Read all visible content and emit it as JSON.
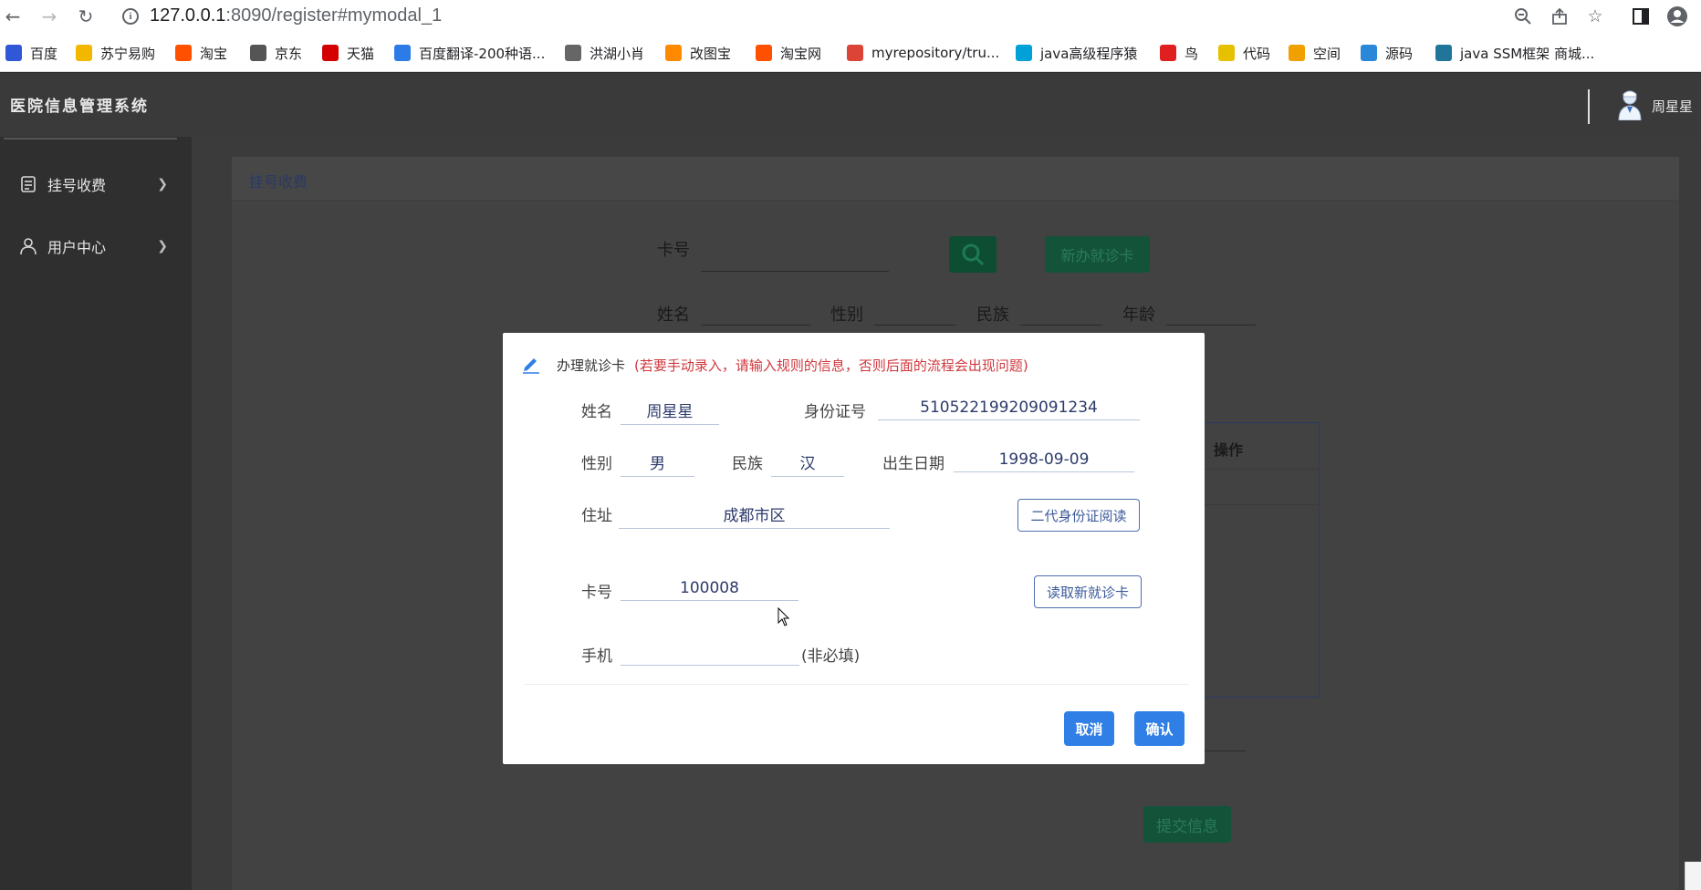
{
  "browser": {
    "url_host": "127.0.0.1",
    "url_rest": ":8090/register#mymodal_1",
    "bookmarks": [
      {
        "label": "百度",
        "icon": "baidu-icon",
        "color": "#2f57d8"
      },
      {
        "label": "苏宁易购",
        "icon": "suning-icon",
        "color": "#f2b800"
      },
      {
        "label": "淘宝",
        "icon": "taobao-icon",
        "color": "#ff5000"
      },
      {
        "label": "京东",
        "icon": "jd-icon",
        "color": "#555555"
      },
      {
        "label": "天猫",
        "icon": "tmall-icon",
        "color": "#d40000"
      },
      {
        "label": "百度翻译-200种语...",
        "icon": "baidu-translate-icon",
        "color": "#2d7be6"
      },
      {
        "label": "洪湖小肖",
        "icon": "bird-icon",
        "color": "#666666"
      },
      {
        "label": "改图宝",
        "icon": "gaitubao-icon",
        "color": "#ff8a00"
      },
      {
        "label": "淘宝网",
        "icon": "taobao-web-icon",
        "color": "#ff5000"
      },
      {
        "label": "myrepository/tru...",
        "icon": "chrome-icon",
        "color": "#db4437"
      },
      {
        "label": "java高级程序猿",
        "icon": "bilibili-icon",
        "color": "#00a1d6"
      },
      {
        "label": "鸟",
        "icon": "red-bird-icon",
        "color": "#e02020"
      },
      {
        "label": "代码",
        "icon": "code-icon",
        "color": "#e5c100"
      },
      {
        "label": "空间",
        "icon": "qzone-icon",
        "color": "#f0a000"
      },
      {
        "label": "源码",
        "icon": "fish-icon",
        "color": "#2b87d8"
      },
      {
        "label": "java SSM框架 商城...",
        "icon": "wordpress-icon",
        "color": "#21759b"
      }
    ]
  },
  "app": {
    "title": "医院信息管理系统",
    "user_name": "周星星"
  },
  "sidebar": {
    "items": [
      {
        "label": "挂号收费",
        "icon": "register-fee-icon"
      },
      {
        "label": "用户中心",
        "icon": "user-center-icon"
      }
    ]
  },
  "page": {
    "panel_title": "挂号收费",
    "bg_fields": {
      "card_no": "卡号",
      "name": "姓名",
      "gender": "性别",
      "ethnicity": "民族",
      "age": "年龄"
    },
    "new_card_button": "新办就诊卡",
    "table_header_op": "操作",
    "submit_button": "提交信息"
  },
  "modal": {
    "title": "办理就诊卡",
    "warning": "(若要手动录入，请输入规则的信息，否则后面的流程会出现问题)",
    "fields": {
      "name_label": "姓名",
      "name_value": "周星星",
      "id_label": "身份证号",
      "id_value": "510522199209091234",
      "gender_label": "性别",
      "gender_value": "男",
      "ethnicity_label": "民族",
      "ethnicity_value": "汉",
      "birth_label": "出生日期",
      "birth_value": "1998-09-09",
      "address_label": "住址",
      "address_value": "成都市区",
      "card_label": "卡号",
      "card_value": "100008",
      "phone_label": "手机",
      "phone_value": "",
      "phone_note": "(非必填)"
    },
    "read_id_button": "二代身份证阅读",
    "read_card_button": "读取新就诊卡",
    "cancel_button": "取消",
    "confirm_button": "确认"
  }
}
